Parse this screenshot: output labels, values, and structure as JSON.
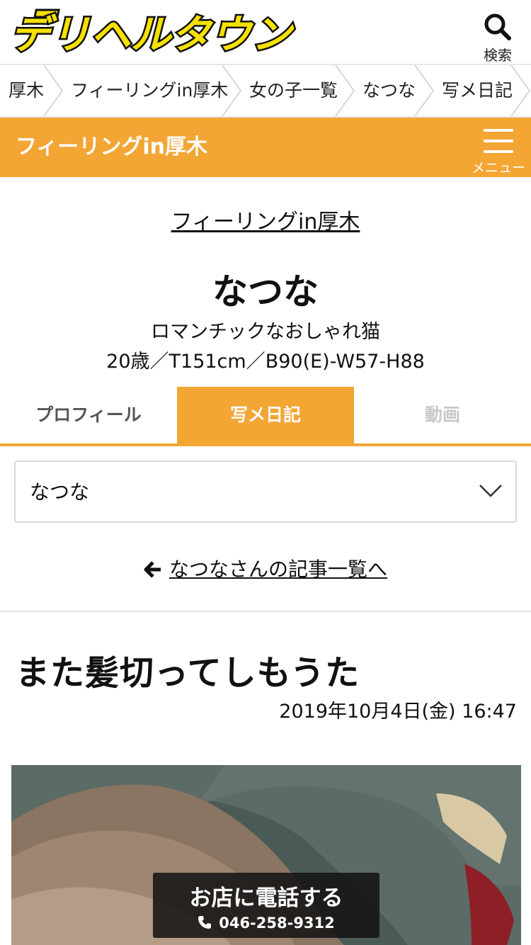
{
  "header": {
    "logo_text": "デリヘルタウン",
    "search_label": "検索"
  },
  "breadcrumb": [
    "厚木",
    "フィーリングin厚木",
    "女の子一覧",
    "なつな",
    "写メ日記"
  ],
  "shop_bar": {
    "title": "フィーリングin厚木",
    "menu_label": "メニュー"
  },
  "profile": {
    "shop_link": "フィーリングin厚木",
    "name": "なつな",
    "catchphrase": "ロマンチックなおしゃれ猫",
    "specs": "20歳／T151cm／B90(E)-W57-H88"
  },
  "tabs": [
    "プロフィール",
    "写メ日記",
    "動画"
  ],
  "active_tab": "写メ日記",
  "girl_select": {
    "value": "なつな"
  },
  "back_link": "なつなさんの記事一覧へ",
  "article": {
    "title": "また髪切ってしもうた",
    "date": "2019年10月4日(金) 16:47"
  },
  "call_button": {
    "label": "お店に電話する",
    "phone": "046-258-9312"
  },
  "colors": {
    "accent": "#f3a634",
    "logo_yellow": "#f5e100",
    "logo_outline": "#111111"
  },
  "icons": [
    "search-icon",
    "menu-icon",
    "chevron-down-icon",
    "arrow-left-icon",
    "phone-icon"
  ]
}
